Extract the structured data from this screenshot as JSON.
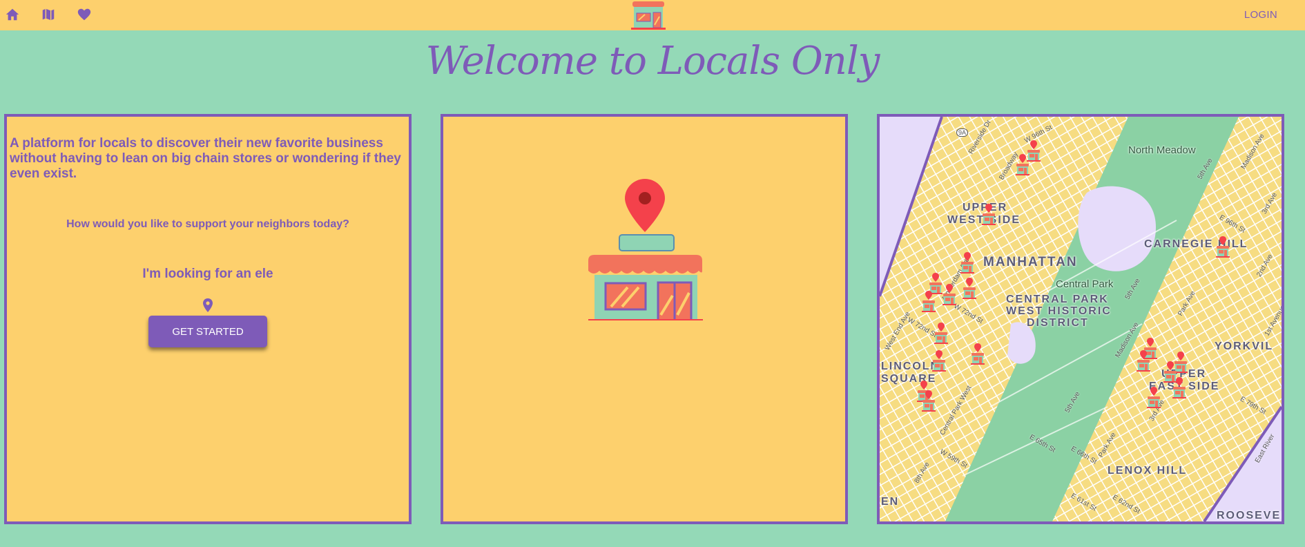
{
  "nav": {
    "home_icon": "home-icon",
    "map_icon": "map-icon",
    "favorites_icon": "heart-icon",
    "login_label": "LOGIN"
  },
  "page": {
    "title": "Welcome to Locals Only"
  },
  "intro": {
    "blurb": "A platform for locals to discover their new favorite business without having to lean on big chain stores or wondering if they even exist.",
    "question": "How would you like to support your neighbors today?",
    "typed_text": "I'm looking for an ele",
    "cta_label": "GET STARTED"
  },
  "map": {
    "area_labels": [
      "North Meadow",
      "UPPER",
      "WEST SIDE",
      "MANHATTAN",
      "Central Park",
      "CENTRAL PARK",
      "WEST HISTORIC",
      "DISTRICT",
      "CARNEGIE HILL",
      "YORKVIL",
      "UPPER",
      "EAST SIDE",
      "LINCOLN",
      "SQUARE",
      "LENOX HILL",
      "ROOSEVEL",
      "EN"
    ],
    "street_labels": [
      "W 96th St",
      "Riverside Dr",
      "Broadway",
      "5th Ave",
      "Madison Ave",
      "3rd Ave",
      "E 96th St",
      "2nd Ave",
      "1st Avenue",
      "Park Ave",
      "5th Ave",
      "Madison Ave",
      "E 79th St",
      "East River",
      "3rd Ave",
      "E 65th St",
      "E 66th St",
      "Park Ave",
      "5th Ave",
      "E 61st St",
      "E 62nd St",
      "W 59th St",
      "8th Ave",
      "West End Ave",
      "Central Park West",
      "Amsterdam Ave",
      "W 72nd St",
      "W 72nd St",
      "9A"
    ]
  },
  "colors": {
    "background": "#94d9b7",
    "bar": "#fdd06d",
    "accent": "#7e5bb8",
    "pin": "#f4414b",
    "awning": "#f2735c",
    "store": "#8fd4b4"
  }
}
